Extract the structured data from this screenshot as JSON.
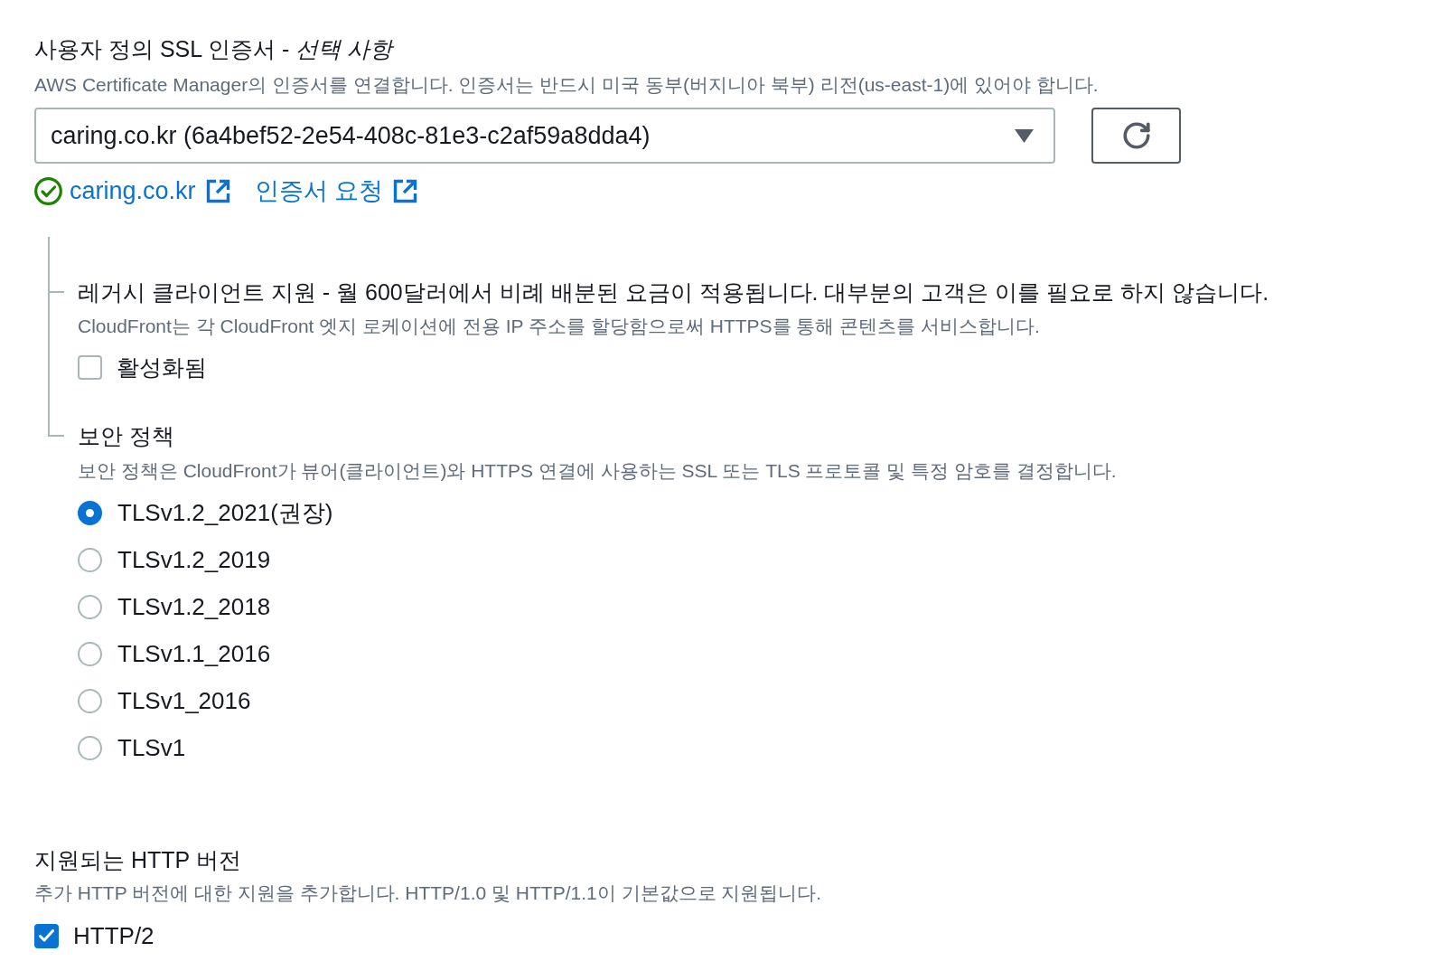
{
  "ssl_certificate": {
    "title": "사용자 정의 SSL 인증서 - *선택 사항*",
    "description": "AWS Certificate Manager의 인증서를 연결합니다. 인증서는 반드시 미국 동부(버지니아 북부) 리전(us-east-1)에 있어야 합니다.",
    "select": {
      "value": "caring.co.kr (6a4bef52-2e54-408c-81e3-c2af59a8dda4)"
    },
    "links": [
      {
        "kind": "status",
        "label": "caring.co.kr"
      },
      {
        "kind": "action",
        "label": "인증서 요청"
      }
    ]
  },
  "legacy_clients": {
    "title": "레거시 클라이언트 지원 - 월 600달러에서 비례 배분된 요금이 적용됩니다. 대부분의 고객은 이를 필요로 하지 않습니다.",
    "description": "CloudFront는 각 CloudFront 엣지 로케이션에 전용 IP 주소를 할당함으로써 HTTPS를 통해 콘텐츠를 서비스합니다.",
    "checkbox": {
      "label": "활성화됨",
      "checked": false
    }
  },
  "security_policy": {
    "title": "보안 정책",
    "description": "보안 정책은 CloudFront가 뷰어(클라이언트)와 HTTPS 연결에 사용하는 SSL 또는 TLS 프로토콜 및 특정 암호를 결정합니다.",
    "options": [
      {
        "label": "TLSv1.2_2021(권장)",
        "selected": true
      },
      {
        "label": "TLSv1.2_2019",
        "selected": false
      },
      {
        "label": "TLSv1.2_2018",
        "selected": false
      },
      {
        "label": "TLSv1.1_2016",
        "selected": false
      },
      {
        "label": "TLSv1_2016",
        "selected": false
      },
      {
        "label": "TLSv1",
        "selected": false
      }
    ]
  },
  "http_versions": {
    "title": "지원되는 HTTP 버전",
    "description": "추가 HTTP 버전에 대한 지원을 추가합니다. HTTP/1.0 및 HTTP/1.1이 기본값으로 지원됩니다.",
    "options": [
      {
        "label": "HTTP/2",
        "checked": true
      }
    ]
  }
}
